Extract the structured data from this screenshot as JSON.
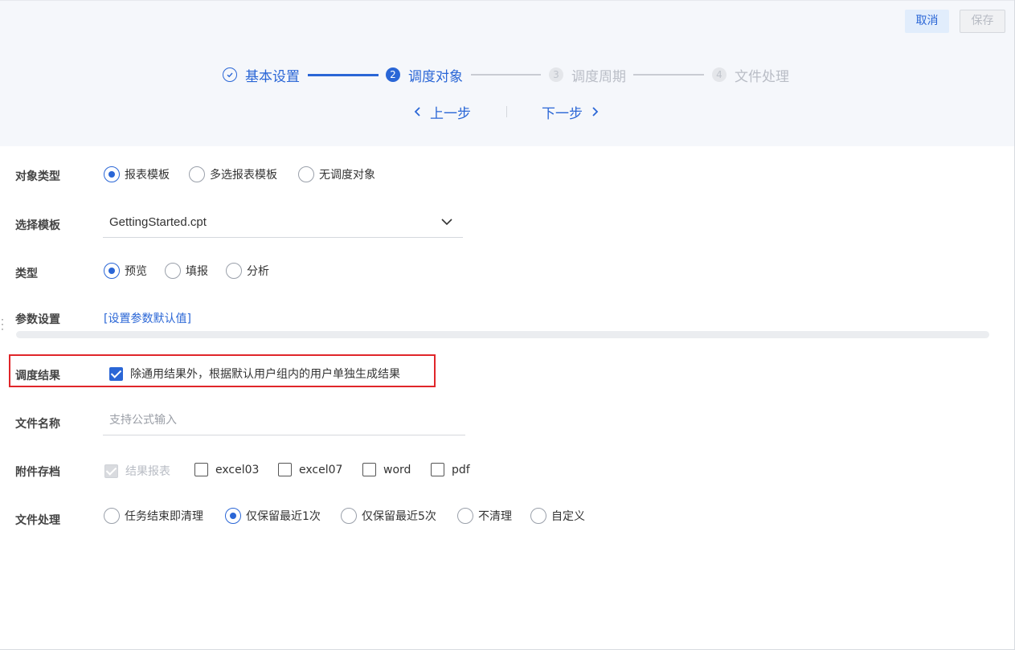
{
  "header": {
    "cancel_label": "取消",
    "save_label": "保存"
  },
  "steps": [
    {
      "num": "",
      "label": "基本设置",
      "state": "done"
    },
    {
      "num": "2",
      "label": "调度对象",
      "state": "active"
    },
    {
      "num": "3",
      "label": "调度周期",
      "state": "todo"
    },
    {
      "num": "4",
      "label": "文件处理",
      "state": "todo"
    }
  ],
  "nav": {
    "prev_label": "上一步",
    "next_label": "下一步"
  },
  "form": {
    "object_type": {
      "label": "对象类型",
      "options": [
        "报表模板",
        "多选报表模板",
        "无调度对象"
      ],
      "selected": "报表模板"
    },
    "template": {
      "label": "选择模板",
      "value": "GettingStarted.cpt"
    },
    "type": {
      "label": "类型",
      "options": [
        "预览",
        "填报",
        "分析"
      ],
      "selected": "预览"
    },
    "params": {
      "label": "参数设置",
      "link": "[设置参数默认值]"
    },
    "result": {
      "label": "调度结果",
      "checkbox_label": "除通用结果外，根据默认用户组内的用户单独生成结果",
      "checked": true
    },
    "filename": {
      "label": "文件名称",
      "placeholder": "支持公式输入"
    },
    "attachment": {
      "label": "附件存档",
      "options": [
        {
          "label": "结果报表",
          "checked": true,
          "disabled": true
        },
        {
          "label": "excel03",
          "checked": false,
          "disabled": false
        },
        {
          "label": "excel07",
          "checked": false,
          "disabled": false
        },
        {
          "label": "word",
          "checked": false,
          "disabled": false
        },
        {
          "label": "pdf",
          "checked": false,
          "disabled": false
        }
      ]
    },
    "file_handling": {
      "label": "文件处理",
      "options": [
        "任务结束即清理",
        "仅保留最近1次",
        "仅保留最近5次",
        "不清理",
        "自定义"
      ],
      "selected": "仅保留最近1次"
    }
  },
  "colors": {
    "accent": "#2a66d6",
    "highlight_border": "#e0262a"
  }
}
